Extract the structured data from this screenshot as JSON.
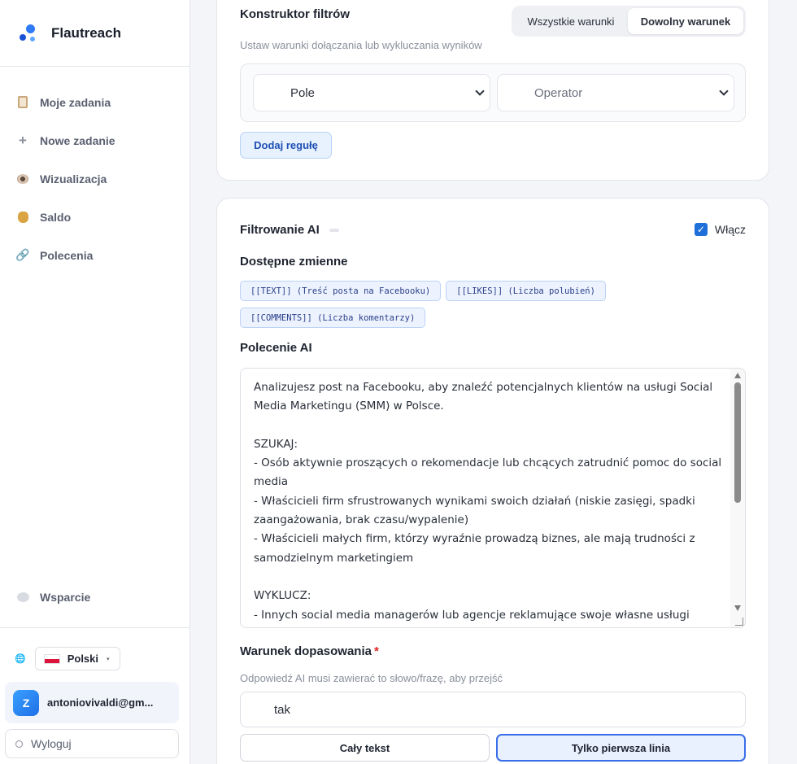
{
  "brand": {
    "name": "Flautreach"
  },
  "nav": {
    "items": [
      {
        "label": "Moje zadania",
        "icon": "clipboard-icon"
      },
      {
        "label": "Nowe zadanie",
        "icon": "plus-icon"
      },
      {
        "label": "Wizualizacja",
        "icon": "eye-icon"
      },
      {
        "label": "Saldo",
        "icon": "money-bag-icon"
      },
      {
        "label": "Polecenia",
        "icon": "link-icon"
      }
    ],
    "support": "Wsparcie",
    "plus_glyph": "+",
    "link_glyph": "🔗"
  },
  "footer": {
    "language": "Polski",
    "globe_glyph": "🌐",
    "caret_glyph": "▾",
    "avatar_letter": "Z",
    "user_email": "antoniovivaldi@gm...",
    "logout": "Wyloguj"
  },
  "filter_builder": {
    "title": "Konstruktor filtrów",
    "subtitle": "Ustaw warunki dołączania lub wykluczania wyników",
    "toggle": {
      "all": "Wszystkie warunki",
      "any": "Dowolny warunek",
      "selected": "any"
    },
    "field_select": "Pole",
    "operator_select": "Operator",
    "add_rule": "Dodaj regułę"
  },
  "ai_filter": {
    "title": "Filtrowanie AI",
    "enabled": true,
    "enable_label": "Włącz",
    "check_glyph": "✓",
    "variables_title": "Dostępne zmienne",
    "variables": [
      "[[TEXT]] (Treść posta na Facebooku)",
      "[[LIKES]] (Liczba polubień)",
      "[[COMMENTS]] (Liczba komentarzy)"
    ],
    "prompt_title": "Polecenie AI",
    "prompt_text": "Analizujesz post na Facebooku, aby znaleźć potencjalnych klientów na usługi Social Media Marketingu (SMM) w Polsce.\n\nSZUKAJ:\n- Osób aktywnie proszących o rekomendacje lub chcących zatrudnić pomoc do social media\n- Właścicieli firm sfrustrowanych wynikami swoich działań (niskie zasięgi, spadki zaangażowania, brak czasu/wypalenie)\n- Właścicieli małych firm, którzy wyraźnie prowadzą biznes, ale mają trudności z samodzielnym marketingiem\n\nWYKLUCZ:\n- Innych social media managerów lub agencje reklamujące swoje własne usługi\n- Generyczne posty motywacyjne lub poradnikowe o marketingu",
    "match_title": "Warunek dopasowania",
    "required_mark": "*",
    "match_hint": "Odpowiedź AI musi zawierać to słowo/frazę, aby przejść",
    "match_value": "tak",
    "mode_full": "Cały tekst",
    "mode_first": "Tylko pierwsza linia",
    "mode_selected": "first"
  }
}
